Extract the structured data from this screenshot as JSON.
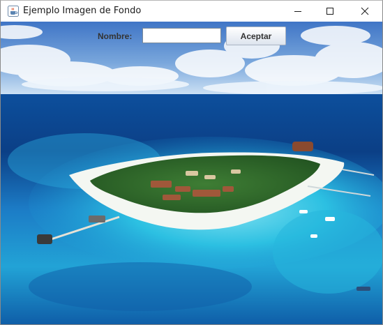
{
  "window": {
    "title": "Ejemplo Imagen de Fondo",
    "app_icon": "java-cup-icon",
    "controls": {
      "minimize_icon": "minimize-icon",
      "maximize_icon": "maximize-icon",
      "close_icon": "close-icon"
    }
  },
  "form": {
    "name_label": "Nombre:",
    "name_value": "",
    "name_placeholder": "",
    "accept_label": "Aceptar"
  },
  "background": {
    "description_icon": "island-background-image",
    "colors": {
      "sky_top": "#3f75c6",
      "sky_horizon": "#cfe4f6",
      "deep_sea": "#0b3f86",
      "lagoon": "#27b7dc",
      "sand": "#f4f7f2",
      "vegetation": "#2f6b2a"
    }
  }
}
